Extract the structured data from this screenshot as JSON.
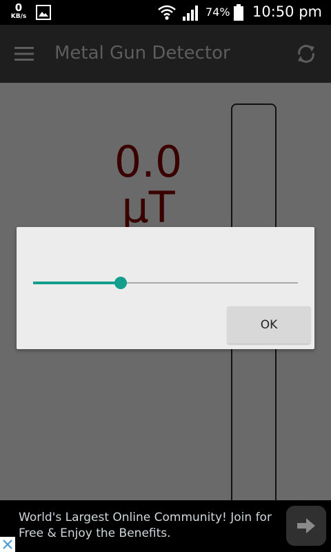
{
  "status_bar": {
    "network_speed_value": "0",
    "network_speed_unit": "KB/s",
    "battery_percent": "74%",
    "time": "10:50 pm",
    "icons": [
      "gallery-icon",
      "wifi-icon",
      "signal-icon",
      "battery-icon"
    ]
  },
  "app_bar": {
    "title": "Metal Gun Detector",
    "menu_icon": "menu-icon",
    "refresh_icon": "refresh-icon"
  },
  "main": {
    "reading_value": "0.0",
    "reading_unit": "µT",
    "reading_color": "#3a0000"
  },
  "dialog": {
    "slider_fraction": 0.33,
    "slider_color": "#139e8e",
    "ok_label": "OK"
  },
  "ad": {
    "text": "World's Largest Online Community! Join for Free & Enjoy the Benefits.",
    "arrow_icon": "arrow-right-icon",
    "close_icon": "close-icon"
  }
}
